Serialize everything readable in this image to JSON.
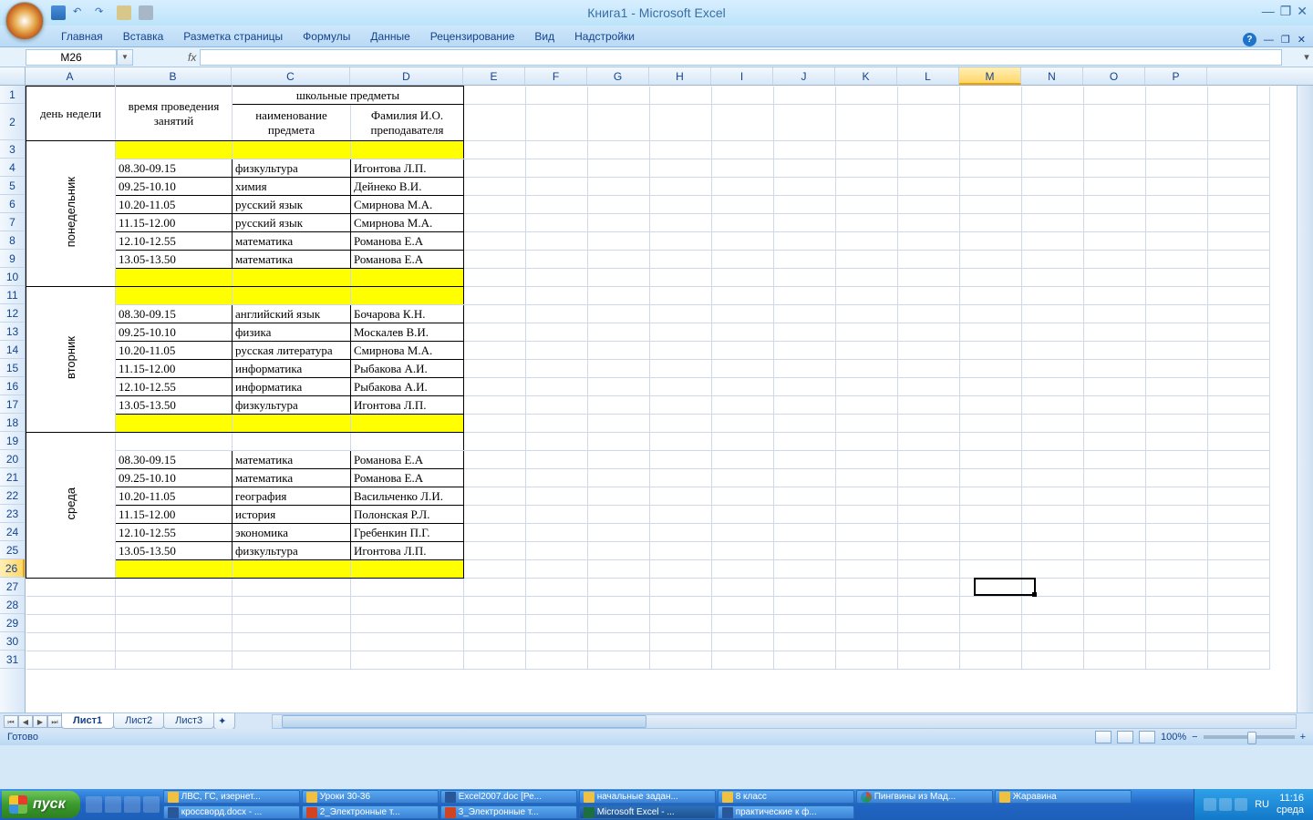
{
  "title": "Книга1 - Microsoft Excel",
  "ribbon": {
    "tabs": [
      "Главная",
      "Вставка",
      "Разметка страницы",
      "Формулы",
      "Данные",
      "Рецензирование",
      "Вид",
      "Надстройки"
    ]
  },
  "name_box": "M26",
  "fx_label": "fx",
  "columns": [
    "A",
    "B",
    "C",
    "D",
    "E",
    "F",
    "G",
    "H",
    "I",
    "J",
    "K",
    "L",
    "M",
    "N",
    "O",
    "P"
  ],
  "row_numbers": [
    1,
    2,
    3,
    4,
    5,
    6,
    7,
    8,
    9,
    10,
    11,
    12,
    13,
    14,
    15,
    16,
    17,
    18,
    19,
    20,
    21,
    22,
    23,
    24,
    25,
    26,
    27,
    28,
    29,
    30,
    31
  ],
  "headers": {
    "a": "день недели",
    "b": "время проведения занятий",
    "cd": "школьные предметы",
    "c": "наименование предмета",
    "d": "Фамилия И.О. преподавателя"
  },
  "days": {
    "mon": "понедельник",
    "tue": "вторник",
    "wed": "среда"
  },
  "schedule": {
    "mon": [
      {
        "t": "08.30-09.15",
        "s": "физкультура",
        "p": "Игонтова Л.П."
      },
      {
        "t": "09.25-10.10",
        "s": "химия",
        "p": "Дейнеко В.И."
      },
      {
        "t": "10.20-11.05",
        "s": "русский язык",
        "p": "Смирнова М.А."
      },
      {
        "t": "11.15-12.00",
        "s": "русский язык",
        "p": "Смирнова М.А."
      },
      {
        "t": "12.10-12.55",
        "s": "математика",
        "p": "Романова Е.А"
      },
      {
        "t": "13.05-13.50",
        "s": "математика",
        "p": "Романова Е.А"
      }
    ],
    "tue": [
      {
        "t": "08.30-09.15",
        "s": "английский язык",
        "p": "Бочарова К.Н."
      },
      {
        "t": "09.25-10.10",
        "s": "физика",
        "p": "Москалев В.И."
      },
      {
        "t": "10.20-11.05",
        "s": "русская литература",
        "p": "Смирнова М.А."
      },
      {
        "t": "11.15-12.00",
        "s": "информатика",
        "p": "Рыбакова А.И."
      },
      {
        "t": "12.10-12.55",
        "s": "информатика",
        "p": "Рыбакова А.И."
      },
      {
        "t": "13.05-13.50",
        "s": "физкультура",
        "p": "Игонтова Л.П."
      }
    ],
    "wed": [
      {
        "t": "08.30-09.15",
        "s": "математика",
        "p": "Романова Е.А"
      },
      {
        "t": "09.25-10.10",
        "s": "математика",
        "p": "Романова Е.А"
      },
      {
        "t": "10.20-11.05",
        "s": "география",
        "p": "Васильченко Л.И."
      },
      {
        "t": "11.15-12.00",
        "s": "история",
        "p": "Полонская Р.Л."
      },
      {
        "t": "12.10-12.55",
        "s": "экономика",
        "p": "Гребенкин П.Г."
      },
      {
        "t": "13.05-13.50",
        "s": "физкультура",
        "p": "Игонтова Л.П."
      }
    ]
  },
  "sheets": [
    "Лист1",
    "Лист2",
    "Лист3"
  ],
  "status": "Готово",
  "zoom": "100%",
  "taskbar": {
    "start": "пуск",
    "items": [
      "ЛВС, ГС, изернет...",
      "Уроки 30-36",
      "Excel2007.doc [Ре...",
      "начальные задан...",
      "8 класс",
      "Пингвины из Мад...",
      "Жаравина",
      "кроссворд.docx - ...",
      "2_Электронные т...",
      "3_Электронные т...",
      "Microsoft Excel - ...",
      "практические к ф..."
    ],
    "active_index": 10,
    "lang": "RU",
    "time": "11:16",
    "date": "среда"
  },
  "active_cell": "M26"
}
